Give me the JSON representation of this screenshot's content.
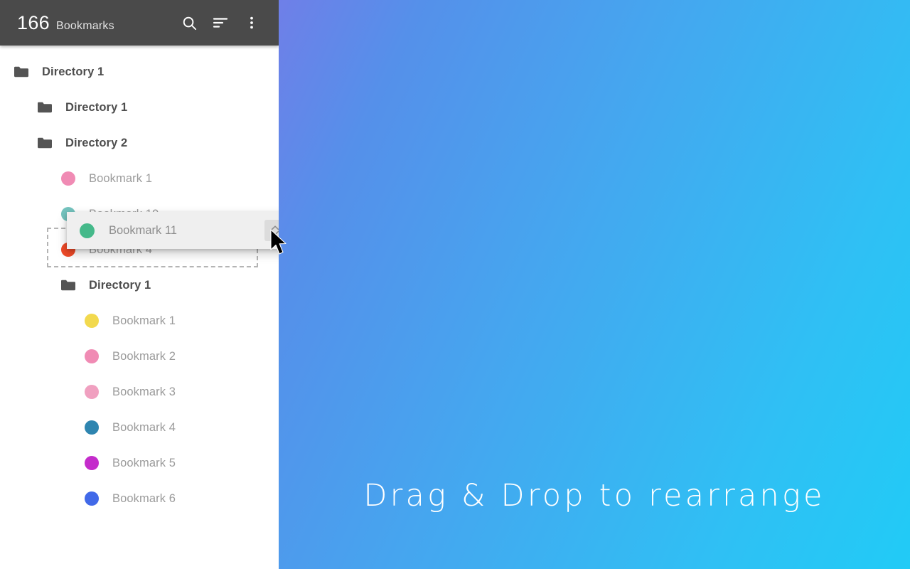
{
  "header": {
    "count": "166",
    "count_label": "Bookmarks",
    "actions": [
      {
        "name": "search-icon",
        "label": "Search"
      },
      {
        "name": "sort-icon",
        "label": "Sort"
      },
      {
        "name": "overflow-menu-icon",
        "label": "More options"
      }
    ]
  },
  "tree": [
    {
      "type": "folder",
      "label": "Directory 1",
      "depth": 0
    },
    {
      "type": "folder",
      "label": "Directory 1",
      "depth": 1
    },
    {
      "type": "folder",
      "label": "Directory 2",
      "depth": 1
    },
    {
      "type": "bookmark",
      "label": "Bookmark 1",
      "depth": 2,
      "color": "#F08BB4"
    },
    {
      "type": "bookmark",
      "label": "Bookmark 10",
      "depth": 2,
      "color": "#74C3BE"
    },
    {
      "type": "bookmark",
      "label": "Bookmark 4",
      "depth": 2,
      "color": "#F04A28"
    },
    {
      "type": "folder",
      "label": "Directory 1",
      "depth": 2
    },
    {
      "type": "bookmark",
      "label": "Bookmark 1",
      "depth": 3,
      "color": "#F2D94E"
    },
    {
      "type": "bookmark",
      "label": "Bookmark 2",
      "depth": 3,
      "color": "#F08BB4"
    },
    {
      "type": "bookmark",
      "label": "Bookmark 3",
      "depth": 3,
      "color": "#F0A0C0"
    },
    {
      "type": "bookmark",
      "label": "Bookmark 4",
      "depth": 3,
      "color": "#2E85B0"
    },
    {
      "type": "bookmark",
      "label": "Bookmark 5",
      "depth": 3,
      "color": "#C42CCB"
    },
    {
      "type": "bookmark",
      "label": "Bookmark 6",
      "depth": 3,
      "color": "#4169E8"
    }
  ],
  "drag": {
    "label": "Bookmark 11",
    "color": "#45B98A",
    "handle_icon": "drag-handle-updown-icon"
  },
  "panel": {
    "tagline": "Drag & Drop to rearrange"
  },
  "colors": {
    "app_bar": "#4a4a4a",
    "gradient_start": "#6f7fe8",
    "gradient_end": "#21cbf6",
    "folder_glyph": "#545454",
    "drop_zone_border": "#b4b4b4"
  }
}
